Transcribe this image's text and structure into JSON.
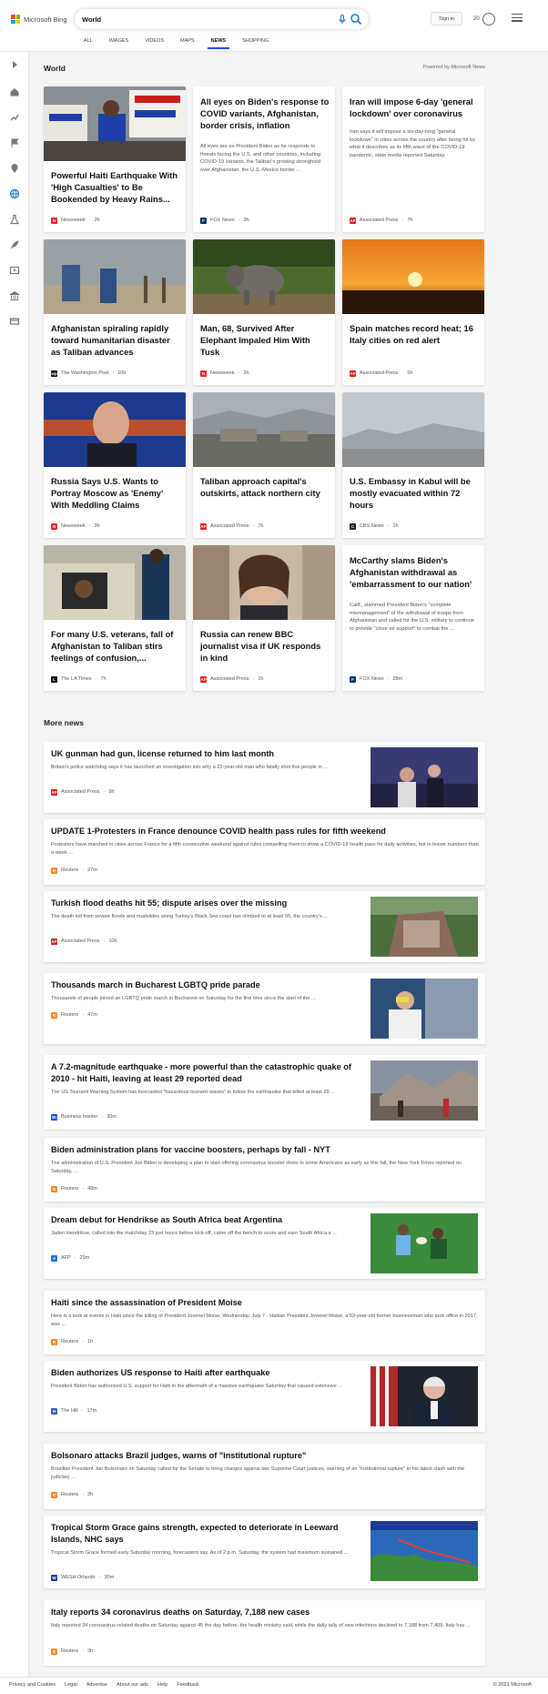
{
  "brand": {
    "name": "Microsoft Bing",
    "colors": [
      "#f25022",
      "#7fba00",
      "#00a4ef",
      "#ffb900"
    ]
  },
  "search": {
    "query": "World"
  },
  "header": {
    "sign_in": "Sign in",
    "rewards_count": "20"
  },
  "tabs": [
    {
      "label": "ALL"
    },
    {
      "label": "IMAGES"
    },
    {
      "label": "VIDEOS"
    },
    {
      "label": "MAPS"
    },
    {
      "label": "NEWS",
      "active": true
    },
    {
      "label": "SHOPPING"
    }
  ],
  "accent_color": "#174ae4",
  "section": {
    "title": "World",
    "powered": "Powered by Microsoft News",
    "more_news": "More news"
  },
  "cards": [
    {
      "title": "Powerful Haiti Earthquake With 'High Casualties' to Be Bookended by Heavy Rains...",
      "source": "Newsweek",
      "time": "2h",
      "logo_color": "#e3242b",
      "logo": "N"
    },
    {
      "title": "All eyes on Biden's response to COVID variants, Afghanistan, border crisis, inflation",
      "snippet": "All eyes are on President Biden as he responds to threats facing the U.S. and other countries, including COVID-19 variants, the Taliban's growing stronghold over Afghanistan, the U.S.-Mexico border ...",
      "source": "FOX News",
      "time": "3h",
      "logo_color": "#003366",
      "logo": "F"
    },
    {
      "title": "Iran will impose 6-day 'general lockdown' over coronavirus",
      "snippet": "Iran says it will impose a six-day-long \"general lockdown\" in cities across the country after being hit by what it describes as its fifth wave of the COVID-19 pandemic, state media reported Saturday.",
      "source": "Associated Press",
      "time": "7h",
      "logo_color": "#e41b17",
      "logo": "AP"
    },
    {
      "title": "Afghanistan spiraling rapidly toward humanitarian disaster as Taliban advances",
      "source": "The Washington Post",
      "time": "10h",
      "logo_color": "#111111",
      "logo": "wp"
    },
    {
      "title": "Man, 68, Survived After Elephant Impaled Him With Tusk",
      "source": "Newsweek",
      "time": "2h",
      "logo_color": "#e3242b",
      "logo": "N"
    },
    {
      "title": "Spain matches record heat; 16 Italy cities on red alert",
      "source": "Associated Press",
      "time": "5h",
      "logo_color": "#e41b17",
      "logo": "AP"
    },
    {
      "title": "Russia Says U.S. Wants to Portray Moscow as 'Enemy' With Meddling Claims",
      "source": "Newsweek",
      "time": "3h",
      "logo_color": "#e3242b",
      "logo": "N"
    },
    {
      "title": "Taliban approach capital's outskirts, attack northern city",
      "source": "Associated Press",
      "time": "7h",
      "logo_color": "#e41b17",
      "logo": "AP"
    },
    {
      "title": "U.S. Embassy in Kabul will be mostly evacuated within 72 hours",
      "source": "CBS News",
      "time": "1h",
      "logo_color": "#222222",
      "logo": "C"
    },
    {
      "title": "For many U.S. veterans, fall of Afghanistan to Taliban stirs feelings of confusion,...",
      "source": "The LA Times",
      "time": "7h",
      "logo_color": "#111111",
      "logo": "L"
    },
    {
      "title": "Russia can renew BBC journalist visa if UK responds in kind",
      "source": "Associated Press",
      "time": "1h",
      "logo_color": "#e41b17",
      "logo": "AP"
    },
    {
      "title": "McCarthy slams Biden's Afghanistan withdrawal as 'embarrassment to our nation'",
      "snippet": "Calif., slammed President Biden's \"complete mismanagement\" of the withdrawal of troops from Afghanistan and called for the U.S. military to continue to provide \"close air support\" to combat the ...",
      "source": "FOX News",
      "time": "28m",
      "logo_color": "#003366",
      "logo": "F"
    }
  ],
  "more_news": [
    {
      "title": "UK gunman had gun, license returned to him last month",
      "snippet": "Britain's police watchdog says it has launched an investigation into why a 22-year-old man who fatally shot five people in ...",
      "source": "Associated Press",
      "time": "9h",
      "logo_color": "#e41b17",
      "logo": "AP"
    },
    {
      "title": "UPDATE 1-Protesters in France denounce COVID health pass rules for fifth weekend",
      "snippet": "Protesters have marched in cities across France for a fifth consecutive weekend against rules compelling them to show a COVID-19 health pass for daily activities, but in lesser numbers than a week ...",
      "source": "Reuters",
      "time": "27m",
      "logo_color": "#f08a24",
      "logo": "R"
    },
    {
      "title": "Turkish flood deaths hit 55; dispute arises over the missing",
      "snippet": "The death toll from severe floods and mudslides along Turkey's Black Sea coast has climbed to at least 55, the country's ...",
      "source": "Associated Press",
      "time": "10h",
      "logo_color": "#e41b17",
      "logo": "AP"
    },
    {
      "title": "Thousands march in Bucharest LGBTQ pride parade",
      "snippet": "Thousands of people joined an LGBTQ pride march in Bucharest on Saturday for the first time since the start of the ...",
      "source": "Reuters",
      "time": "47m",
      "logo_color": "#f08a24",
      "logo": "R"
    },
    {
      "title": "A 7.2-magnitude earthquake - more powerful than the catastrophic quake of 2010 - hit Haiti, leaving at least 29 reported dead",
      "snippet": "The US Tsunami Warning System has forecasted \"hazardous tsunami waves\" to follow the earthquake that killed at least 29 ...",
      "source": "Business Insider",
      "time": "30m",
      "logo_color": "#1f4ae0",
      "logo": "BI"
    },
    {
      "title": "Biden administration plans for vaccine boosters, perhaps by fall - NYT",
      "snippet": "The administration of U.S. President Joe Biden is developing a plan to start offering coronavirus booster shots to some Americans as early as this fall, the New York Times reported on Saturday, ...",
      "source": "Reuters",
      "time": "49m",
      "logo_color": "#f08a24",
      "logo": "R"
    },
    {
      "title": "Dream debut for Hendrikse as South Africa beat Argentina",
      "snippet": "Jaden Hendrikse, called into the matchday 23 just hours before kick-off, came off the bench to score and earn South Africa a ...",
      "source": "AFP",
      "time": "29m",
      "logo_color": "#1e6fd9",
      "logo": "A"
    },
    {
      "title": "Haiti since the assassination of President Moise",
      "snippet": "Here is a look at events in Haiti since the killing of President Jovenel Moise. Wednesday, July 7 - Haitian President Jovenel Moise, a 53-year-old former businessman who took office in 2017, was ...",
      "source": "Reuters",
      "time": "1h",
      "logo_color": "#f08a24",
      "logo": "R"
    },
    {
      "title": "Biden authorizes US response to Haiti after earthquake",
      "snippet": "President Biden has authorized U.S. support for Haiti in the aftermath of a massive earthquake Saturday that caused extensive ...",
      "source": "The Hill",
      "time": "17m",
      "logo_color": "#3a5bb0",
      "logo": "H"
    },
    {
      "title": "Bolsonaro attacks Brazil judges, warns of \"institutional rupture\"",
      "snippet": "Brazilian President Jair Bolsonaro on Saturday called for the Senate to bring charges against two Supreme Court justices, warning of an \"institutional rupture\" in his latest clash with the judiciary ...",
      "source": "Reuters",
      "time": "2h",
      "logo_color": "#f08a24",
      "logo": "R"
    },
    {
      "title": "Tropical Storm Grace gains strength, expected to deteriorate in Leeward Islands, NHC says",
      "snippet": "Tropical Storm Grace formed early Saturday morning, forecasters say. As of 2 p.m. Saturday, the system had maximum sustained ...",
      "source": "WESH Orlando",
      "time": "30m",
      "logo_color": "#1a3d8f",
      "logo": "W"
    },
    {
      "title": "Italy reports 34 coronavirus deaths on Saturday, 7,188 new cases",
      "snippet": "Italy reported 34 coronavirus-related deaths on Saturday against 45 the day before, the health ministry said, while the daily tally of new infections declined to 7,188 from 7,409. Italy has ...",
      "source": "Reuters",
      "time": "3h",
      "logo_color": "#f08a24",
      "logo": "R"
    }
  ],
  "footer": {
    "links": [
      "Privacy and Cookies",
      "Legal",
      "Advertise",
      "About our ads",
      "Help",
      "Feedback"
    ],
    "copyright": "© 2021 Microsoft"
  }
}
